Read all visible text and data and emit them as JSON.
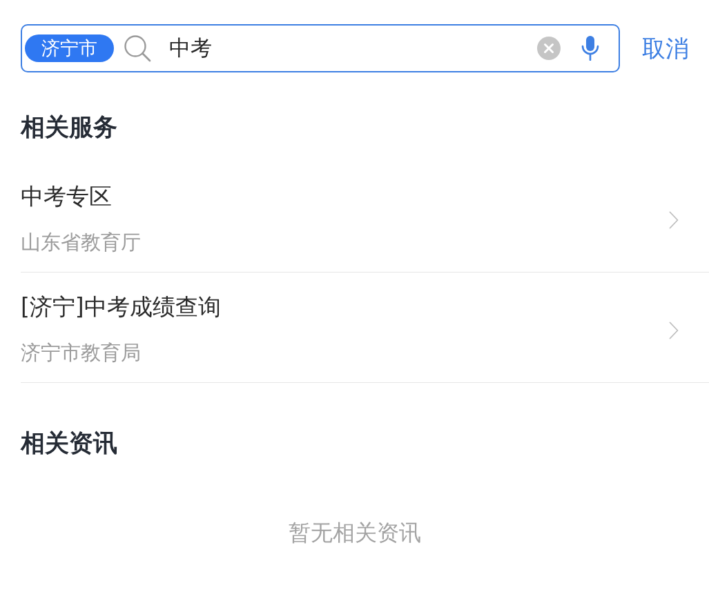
{
  "search_bar": {
    "city": "济宁市",
    "query": "中考",
    "cancel": "取消"
  },
  "sections": [
    {
      "kind": "services",
      "title": "相关服务",
      "items": [
        {
          "title": "中考专区",
          "subtitle": "山东省教育厅"
        },
        {
          "title": "[济宁]中考成绩查询",
          "subtitle": "济宁市教育局"
        }
      ]
    },
    {
      "kind": "news",
      "title": "相关资讯",
      "empty_text": "暂无相关资讯"
    }
  ]
}
